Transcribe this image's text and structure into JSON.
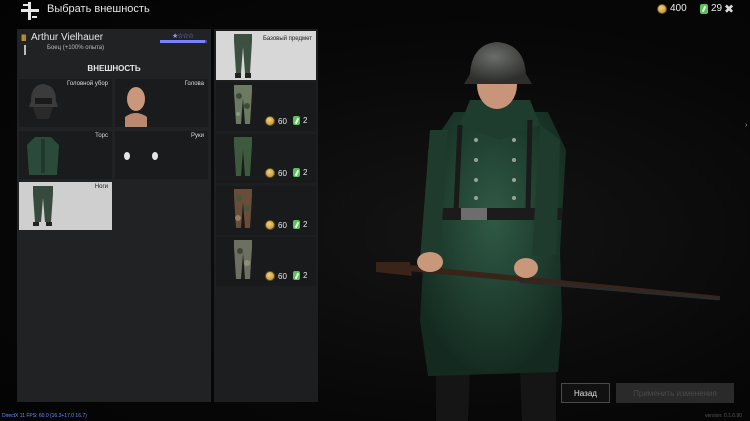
{
  "header": {
    "title": "Выбрать внешность"
  },
  "currency": {
    "silver": "400",
    "tickets": "29"
  },
  "soldier": {
    "rank": "III",
    "name": "Arthur Vielhauer",
    "subtitle": "Боец  (+100% опыта)",
    "stars": "★☆☆☆",
    "xp_progress": 0.95
  },
  "appearance": {
    "section_title": "ВНЕШНОСТЬ",
    "slots": [
      {
        "label": "Головной убор"
      },
      {
        "label": "Голова"
      },
      {
        "label": "Торс"
      },
      {
        "label": "Руки"
      },
      {
        "label": "Ноги"
      }
    ]
  },
  "items": [
    {
      "label": "Базовый предмет"
    },
    {
      "price": "60",
      "tickets": "2"
    },
    {
      "price": "60",
      "tickets": "2"
    },
    {
      "price": "60",
      "tickets": "2"
    },
    {
      "price": "60",
      "tickets": "2"
    }
  ],
  "buttons": {
    "back": "Назад",
    "confirm": "Применить изменения"
  },
  "debug": {
    "fps": "DirectX 11 FPS: 60.0 (16.3+17.0 16.7)",
    "version": "version: 0.1.0.90"
  },
  "colors": {
    "gold": "#c99b2a",
    "xp": "#7682ff",
    "panel": "#232526",
    "selected_slot": "#cfcfcf"
  }
}
